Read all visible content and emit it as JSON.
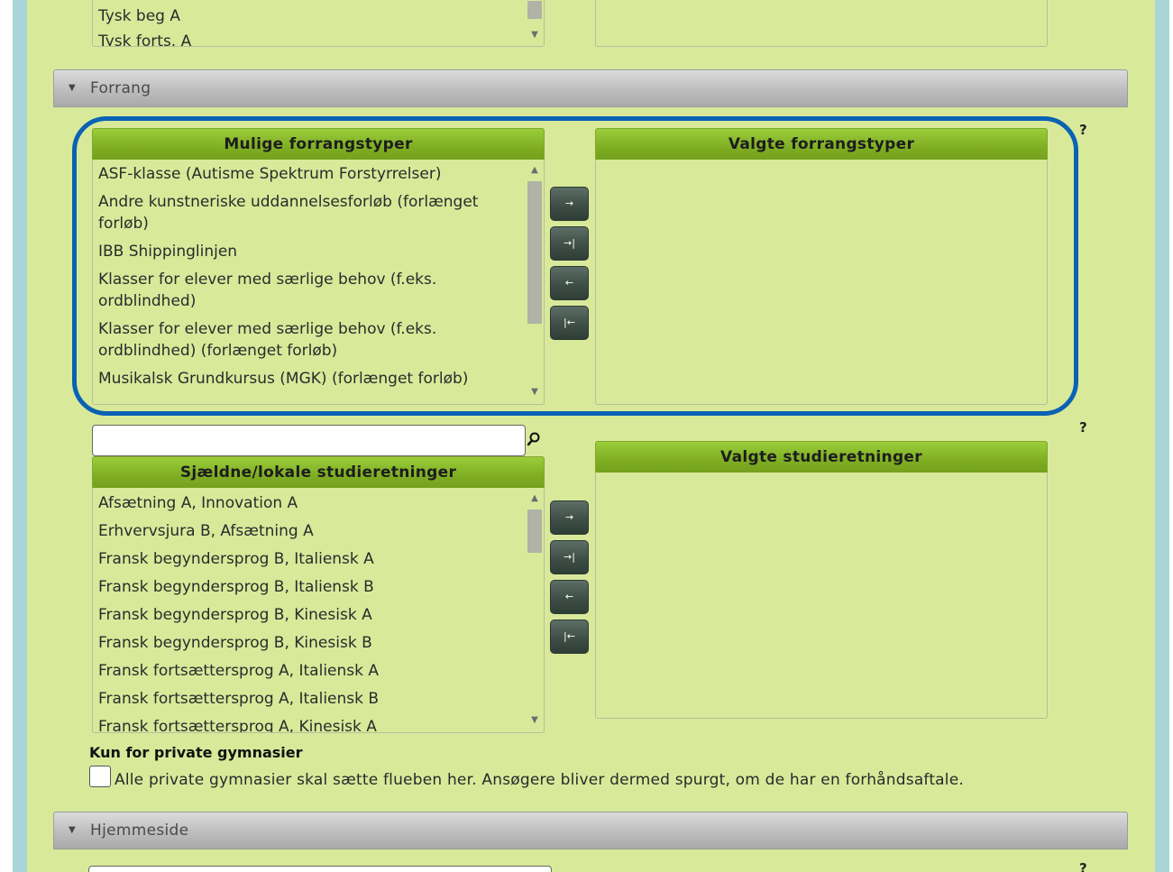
{
  "top_list": {
    "items": [
      "Tysk beg A",
      "Tysk forts. A"
    ]
  },
  "forrang_section": {
    "title": "Forrang",
    "available": {
      "header": "Mulige forrangstyper",
      "items": [
        "ASF-klasse (Autisme Spektrum Forstyrrelser)",
        "Andre kunstneriske uddannelsesforløb (forlænget forløb)",
        "IBB Shippinglinjen",
        "Klasser for elever med særlige behov (f.eks. ordblindhed)",
        "Klasser for elever med særlige behov (f.eks. ordblindhed) (forlænget forløb)",
        "Musikalsk Grundkursus (MGK) (forlænget forløb)"
      ]
    },
    "selected": {
      "header": "Valgte forrangstyper"
    },
    "help": "?",
    "buttons": {
      "add": "→",
      "add_all": "→|",
      "remove": "←",
      "remove_all": "|←"
    },
    "highlight_color": "#0a62b4"
  },
  "studieretninger": {
    "search": {
      "value": "",
      "icon": "search-icon"
    },
    "available": {
      "header": "Sjældne/lokale studieretninger",
      "items": [
        "Afsætning A, Innovation A",
        "Erhvervsjura B, Afsætning A",
        "Fransk begyndersprog B, Italiensk A",
        "Fransk begyndersprog B, Italiensk B",
        "Fransk begyndersprog B, Kinesisk A",
        "Fransk begyndersprog B, Kinesisk B",
        "Fransk fortsættersprog A, Italiensk A",
        "Fransk fortsættersprog A, Italiensk B",
        "Fransk fortsættersprog A, Kinesisk A"
      ]
    },
    "selected": {
      "header": "Valgte studieretninger"
    },
    "help": "?",
    "buttons": {
      "add": "→",
      "add_all": "→|",
      "remove": "←",
      "remove_all": "|←"
    }
  },
  "private": {
    "heading": "Kun for private gymnasier",
    "checkbox_label": "Alle private gymnasier skal sætte flueben her. Ansøgere bliver dermed spurgt, om de har en forhåndsaftale.",
    "checked": false
  },
  "hjemmeside_section": {
    "title": "Hjemmeside",
    "help": "?"
  },
  "colors": {
    "page_bg": "#d9e99a",
    "header_green": "#7fae24",
    "frame": "#a9d5d8",
    "section_gray": "#bdbdbd"
  }
}
